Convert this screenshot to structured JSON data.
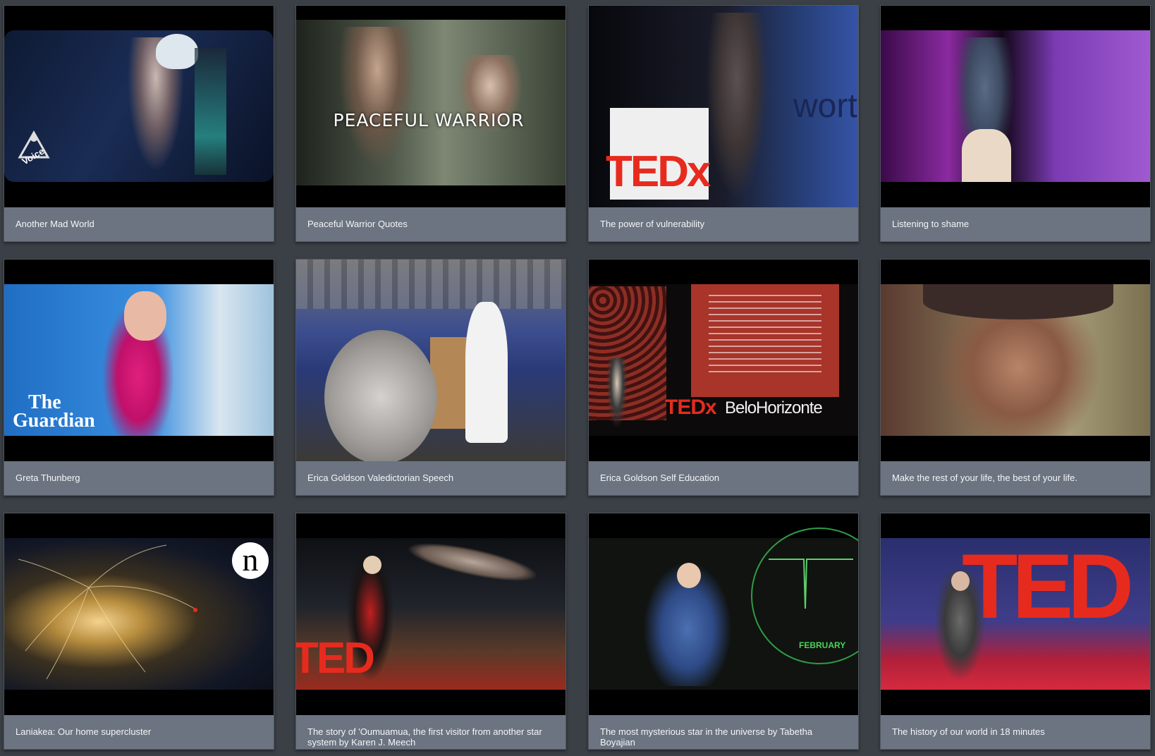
{
  "videos": [
    {
      "title": "Another Mad World",
      "thumb_icon": "voice-logo-icon",
      "thumb_text": "Voice"
    },
    {
      "title": "Peaceful Warrior Quotes",
      "thumb_text": "PEACEFUL WARRIOR"
    },
    {
      "title": "The power of vulnerability",
      "thumb_text": "TEDx",
      "thumb_text2": "worth"
    },
    {
      "title": "Listening to shame"
    },
    {
      "title": "Greta Thunberg",
      "thumb_text": "The",
      "thumb_text2": "Guardian"
    },
    {
      "title": "Erica Goldson Valedictorian Speech"
    },
    {
      "title": "Erica Goldson Self Education",
      "thumb_text": "TEDx",
      "thumb_text2": "BeloHorizonte"
    },
    {
      "title": "Make the rest of your life, the best of your life."
    },
    {
      "title": "Laniakea: Our home supercluster",
      "thumb_icon": "nautilus-logo-icon",
      "thumb_text": "n"
    },
    {
      "title": "The story of 'Oumuamua, the first visitor from another star system by Karen J. Meech",
      "thumb_text": "TED"
    },
    {
      "title": "The most mysterious star in the universe by Tabetha Boyajian",
      "thumb_text": "FEBRUARY"
    },
    {
      "title": "The history of our world in 18 minutes",
      "thumb_text": "TED"
    }
  ],
  "colors": {
    "page_bg": "#3b4046",
    "card_bg": "#6b7480",
    "title_text": "#f4f6f8",
    "ted_red": "#e62b1e"
  }
}
